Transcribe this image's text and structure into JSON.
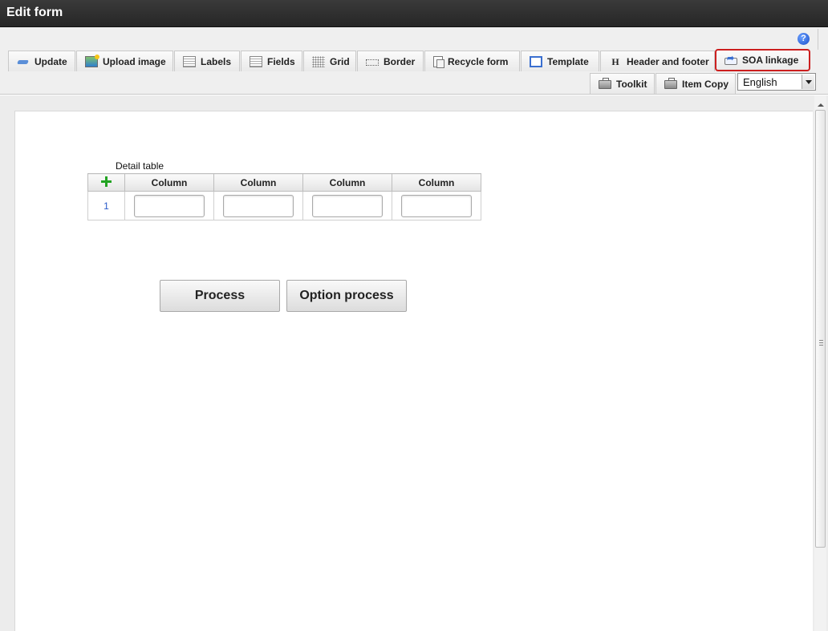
{
  "window": {
    "title": "Edit form"
  },
  "toolbar": {
    "help_label": "?",
    "row1": [
      {
        "label": "Update",
        "icon": "update-icon"
      },
      {
        "label": "Upload image",
        "icon": "upload-image-icon"
      },
      {
        "label": "Labels",
        "icon": "labels-icon"
      },
      {
        "label": "Fields",
        "icon": "fields-icon"
      },
      {
        "label": "Grid",
        "icon": "grid-icon"
      },
      {
        "label": "Border",
        "icon": "border-icon"
      },
      {
        "label": "Recycle form",
        "icon": "recycle-form-icon"
      },
      {
        "label": "Template",
        "icon": "template-icon"
      },
      {
        "label": "Header and footer",
        "icon": "header-footer-icon"
      },
      {
        "label": "SOA linkage",
        "icon": "soa-linkage-icon",
        "highlighted": true
      }
    ],
    "row2": [
      {
        "label": "Toolkit",
        "icon": "toolkit-icon"
      },
      {
        "label": "Item Copy",
        "icon": "item-copy-icon"
      }
    ],
    "language": {
      "selected": "English"
    }
  },
  "form": {
    "detail_table": {
      "label": "Detail table",
      "columns": [
        "Column",
        "Column",
        "Column",
        "Column"
      ],
      "rows": [
        {
          "number": "1",
          "values": [
            "",
            "",
            "",
            ""
          ]
        }
      ]
    },
    "buttons": {
      "process": "Process",
      "option_process": "Option process"
    }
  },
  "colors": {
    "titlebar": "#2e2e2e",
    "highlight_border": "#cc1f1f",
    "add_icon": "#22a322",
    "row_number": "#2a5ac9"
  }
}
